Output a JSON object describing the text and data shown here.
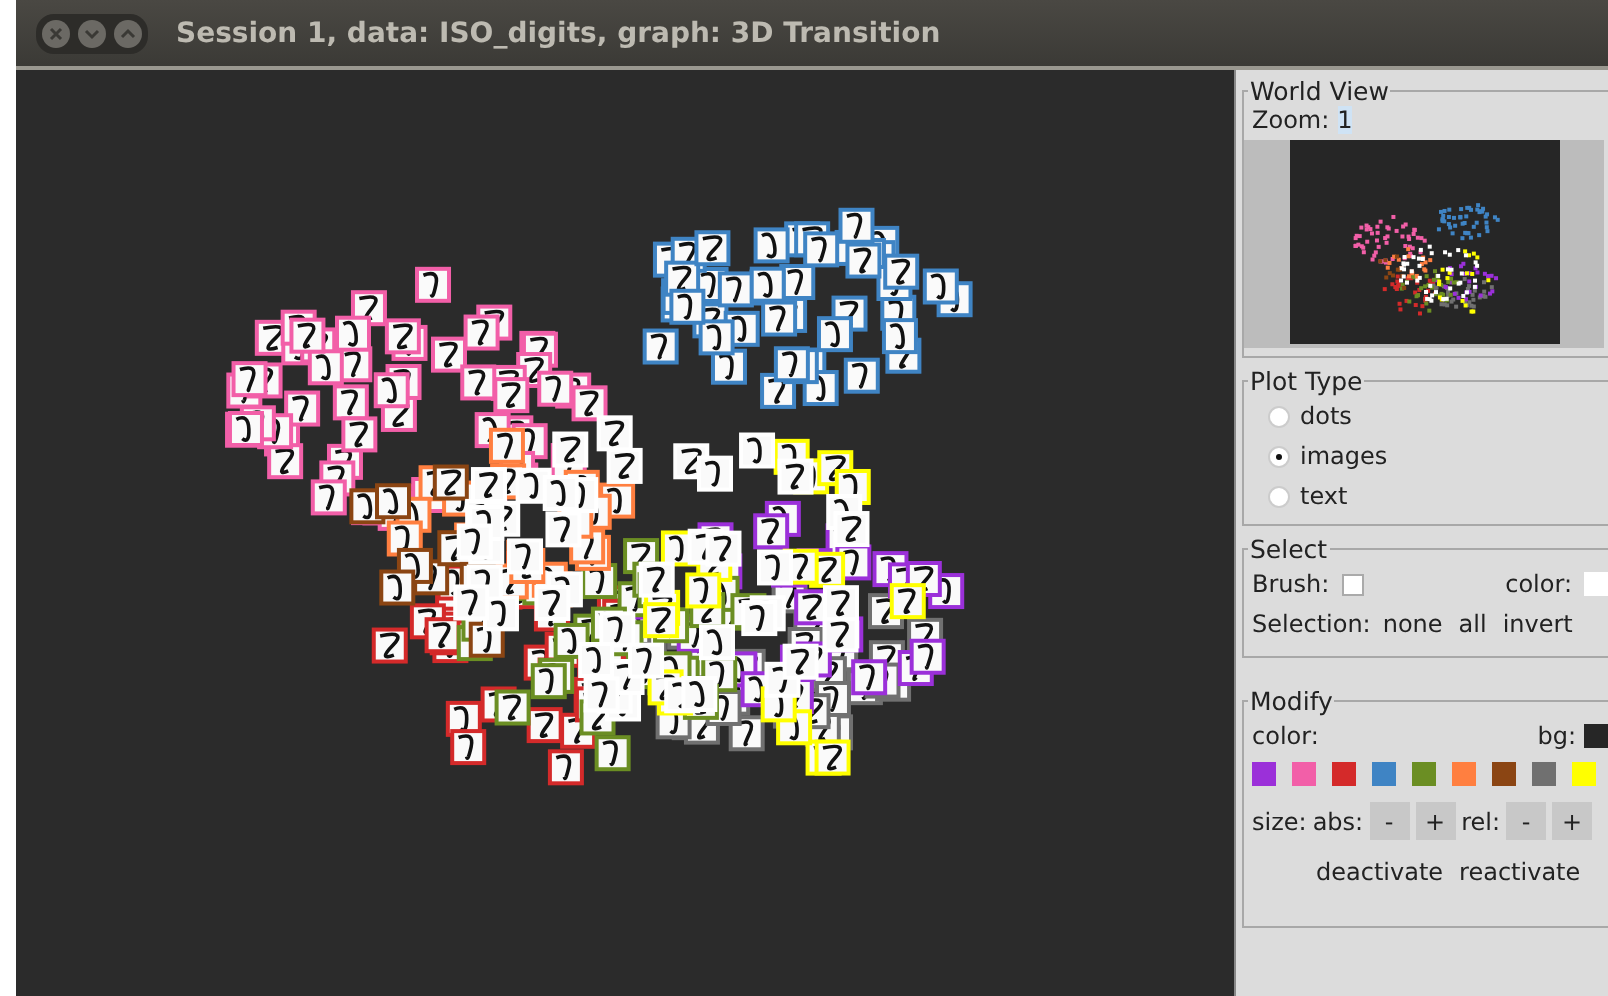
{
  "window": {
    "title": "Session 1, data: ISO_digits, graph: 3D Transition"
  },
  "world_view": {
    "title": "World View",
    "zoom_label": "Zoom:",
    "zoom_value": "1"
  },
  "plot_type": {
    "title": "Plot Type",
    "options": [
      {
        "label": "dots",
        "selected": false
      },
      {
        "label": "images",
        "selected": true
      },
      {
        "label": "text",
        "selected": false
      }
    ]
  },
  "select": {
    "title": "Select",
    "brush_label": "Brush:",
    "brush_checked": false,
    "color_label": "color:",
    "selection_label": "Selection:",
    "actions": [
      "none",
      "all",
      "invert"
    ]
  },
  "modify": {
    "title": "Modify",
    "color_label": "color:",
    "bg_label": "bg:",
    "swatches": [
      {
        "color": "#9b30d9"
      },
      {
        "color": "#f25fa8"
      },
      {
        "color": "#d42a2a"
      },
      {
        "color": "#3f84c4"
      },
      {
        "color": "#6b8e23"
      },
      {
        "color": "#ff7f40"
      },
      {
        "color": "#8b4513"
      },
      {
        "color": "#707070"
      },
      {
        "color": "#ffff00"
      }
    ],
    "size_label": "size:",
    "abs_label": "abs:",
    "abs_buttons": [
      "-",
      "+"
    ],
    "rel_label": "rel:",
    "rel_buttons": [
      "-",
      "+"
    ],
    "actions": [
      "deactivate",
      "reactivate"
    ]
  }
}
